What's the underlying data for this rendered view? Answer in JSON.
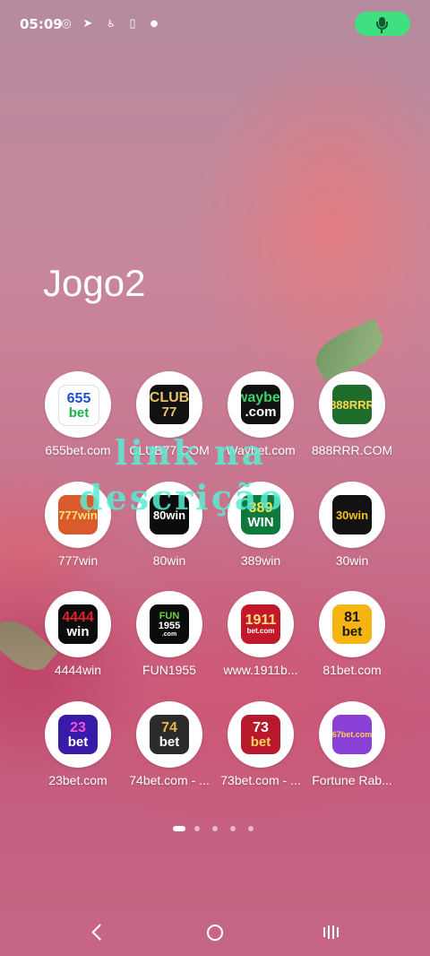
{
  "status_bar": {
    "time": "05:09",
    "icons": [
      "settings-ring-icon",
      "telegram-icon",
      "accessibility-icon",
      "battery-saver-icon",
      "notification-dot-icon"
    ],
    "mic_color": "#3ee07f"
  },
  "folder": {
    "title": "Jogo2"
  },
  "apps": [
    {
      "label": "655bet.com",
      "logo_lines": [
        "655",
        "bet"
      ],
      "bg": "#ffffff",
      "fg": "#1d4fd6",
      "accent": "#19b34a"
    },
    {
      "label": "CLUB77.COM",
      "logo_lines": [
        "CLUB",
        "77"
      ],
      "bg": "#111111",
      "fg": "#e9c36a",
      "accent": "#e9c36a"
    },
    {
      "label": "Waybet.com",
      "logo_lines": [
        "waybet",
        ".com"
      ],
      "bg": "#111111",
      "fg": "#3bd36a",
      "accent": "#ffffff"
    },
    {
      "label": "888RRR.COM",
      "logo_lines": [
        "888RRR"
      ],
      "bg": "#1f6d2a",
      "fg": "#ffd34d",
      "accent": "#e8442f"
    },
    {
      "label": "777win",
      "logo_lines": [
        "777win"
      ],
      "bg": "#d95a2a",
      "fg": "#ffe07a",
      "accent": "#8a2a0a"
    },
    {
      "label": "80win",
      "logo_lines": [
        "80win"
      ],
      "bg": "#0c0c0c",
      "fg": "#ffffff",
      "accent": "#ffffff"
    },
    {
      "label": "389win",
      "logo_lines": [
        "389",
        "WIN"
      ],
      "bg": "#0d7a3c",
      "fg": "#ffe14a",
      "accent": "#ffffff"
    },
    {
      "label": "30win",
      "logo_lines": [
        "30win"
      ],
      "bg": "#121212",
      "fg": "#f4c21b",
      "accent": "#ffffff"
    },
    {
      "label": "4444win",
      "logo_lines": [
        "4444",
        "win"
      ],
      "bg": "#0c0c0c",
      "fg": "#e0232a",
      "accent": "#ffffff"
    },
    {
      "label": "FUN1955",
      "logo_lines": [
        "FUN",
        "1955",
        ".com"
      ],
      "bg": "#0c0c0c",
      "fg": "#6ad23a",
      "accent": "#ffffff"
    },
    {
      "label": "www.1911b...",
      "logo_lines": [
        "1911",
        "bet.com"
      ],
      "bg": "#c3182a",
      "fg": "#ffe27a",
      "accent": "#ffffff"
    },
    {
      "label": "81bet.com",
      "logo_lines": [
        "81",
        "bet"
      ],
      "bg": "#f5b40f",
      "fg": "#1a1a1a",
      "accent": "#1a1a1a"
    },
    {
      "label": "23bet.com",
      "logo_lines": [
        "23",
        "bet"
      ],
      "bg": "#3a1aa8",
      "fg": "#ff4fd8",
      "accent": "#ffffff"
    },
    {
      "label": "74bet.com - ...",
      "logo_lines": [
        "74",
        "bet"
      ],
      "bg": "#2b2b2b",
      "fg": "#e9b44a",
      "accent": "#ffffff"
    },
    {
      "label": "73bet.com - ...",
      "logo_lines": [
        "73",
        "bet"
      ],
      "bg": "#b8192c",
      "fg": "#ffffff",
      "accent": "#ffd65a"
    },
    {
      "label": "Fortune Rab...",
      "logo_lines": [
        "67bet.com"
      ],
      "bg": "#8a3fd6",
      "fg": "#ffd34d",
      "accent": "#ff7ab8"
    }
  ],
  "watermark": {
    "line1": "link na",
    "line2": "descrição"
  },
  "pagination": {
    "pages": 5,
    "active": 0
  },
  "nav": {
    "icons": [
      "back-icon",
      "home-icon",
      "recents-icon"
    ]
  }
}
